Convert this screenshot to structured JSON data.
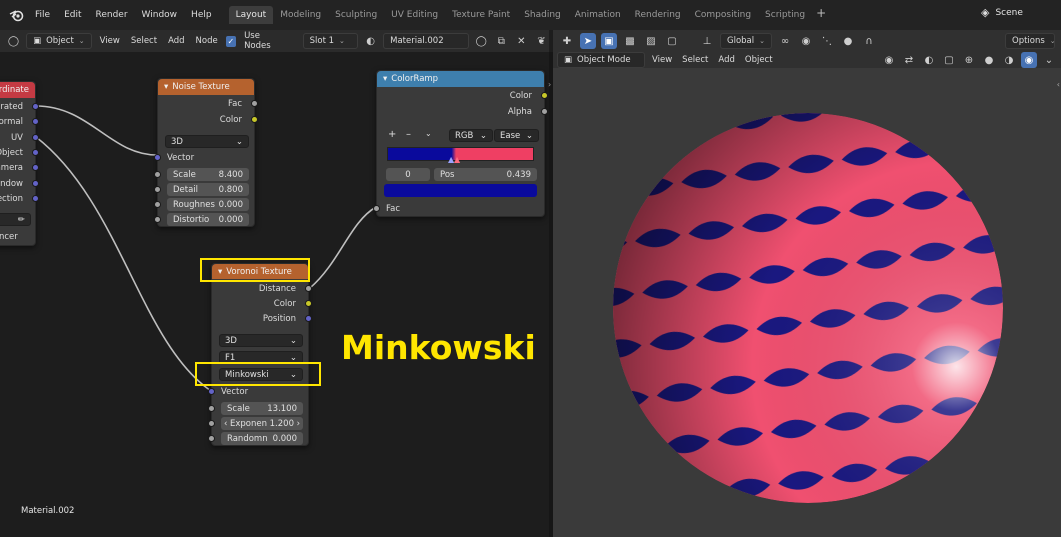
{
  "topbar": {
    "menus": [
      "File",
      "Edit",
      "Render",
      "Window",
      "Help"
    ],
    "workspaces": [
      "Layout",
      "Modeling",
      "Sculpting",
      "UV Editing",
      "Texture Paint",
      "Shading",
      "Animation",
      "Rendering",
      "Compositing",
      "Scripting"
    ],
    "active_workspace": "Layout",
    "scene": "Scene"
  },
  "node_header": {
    "object_type": "Object",
    "view": "View",
    "select": "Select",
    "add": "Add",
    "node": "Node",
    "use_nodes": "Use Nodes",
    "slot": "Slot 1",
    "material": "Material.002"
  },
  "view_header": {
    "transform": "Global",
    "options": "Options",
    "mode": "Object Mode",
    "view": "View",
    "select": "Select",
    "add": "Add",
    "object": "Object"
  },
  "tex_coord_node": {
    "title": "rdinate",
    "outputs": [
      "erated",
      "ormal",
      "UV",
      "Object",
      "amera",
      "indow",
      "ection"
    ],
    "instancer": "ncer"
  },
  "noise_node": {
    "title": "Noise Texture",
    "outputs": [
      "Fac",
      "Color"
    ],
    "dimensions": "3D",
    "vector": "Vector",
    "fields": [
      {
        "label": "Scale",
        "value": "8.400"
      },
      {
        "label": "Detail",
        "value": "0.800"
      },
      {
        "label": "Roughnes",
        "value": "0.000"
      },
      {
        "label": "Distortio",
        "value": "0.000"
      }
    ]
  },
  "colorramp_node": {
    "title": "ColorRamp",
    "outputs": [
      "Color",
      "Alpha"
    ],
    "mode": "RGB",
    "interp": "Ease",
    "stop_index": "0",
    "pos_label": "Pos",
    "pos_value": "0.439",
    "fac": "Fac",
    "colors": {
      "stop0": "#0a0a9c",
      "stop1": "#ef3f63"
    }
  },
  "voronoi_node": {
    "title": "Voronoi Texture",
    "outputs": [
      "Distance",
      "Color",
      "Position"
    ],
    "dimensions": "3D",
    "feature": "F1",
    "metric": "Minkowski",
    "vector": "Vector",
    "fields": [
      {
        "label": "Scale",
        "value": "13.100"
      },
      {
        "label": "Exponen",
        "value": "1.200"
      },
      {
        "label": "Randomn",
        "value": "0.000"
      }
    ]
  },
  "annotation": "Minkowski",
  "material_label": "Material.002",
  "sphere_colors": {
    "pink": "#f05070",
    "blue": "#1a1880"
  }
}
